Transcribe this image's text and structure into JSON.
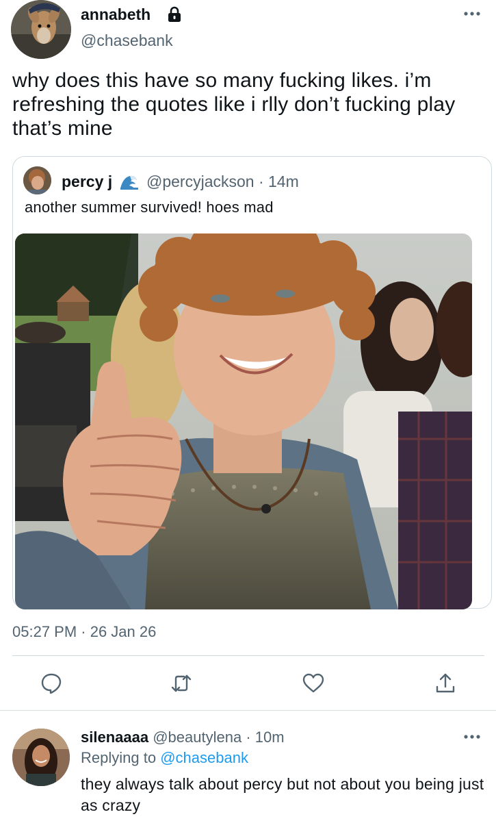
{
  "main_tweet": {
    "display_name": "annabeth",
    "handle": "@chasebank",
    "avatar_icon": "deer-avatar-icon",
    "protected_icon": "lock-icon",
    "text": "why does this have so many fucking likes. i’m refreshing the quotes like i rlly don’t fucking play that’s mine",
    "timestamp": "05:27 PM · 26 Jan 26"
  },
  "quoted_tweet": {
    "display_name": "percy j",
    "name_emoji_icon": "wave-icon",
    "handle": "@percyjackson",
    "age": "· 14m",
    "text": "another summer survived! hoes mad"
  },
  "actions": {
    "reply_icon": "reply-icon",
    "retweet_icon": "retweet-icon",
    "like_icon": "heart-icon",
    "share_icon": "share-icon"
  },
  "reply": {
    "display_name": "silenaaaa",
    "handle": "@beautylena",
    "age": "· 10m",
    "replying_label": "Replying to",
    "replying_handle": "@chasebank",
    "text": "they always talk about percy but not about you being just as crazy"
  },
  "colors": {
    "text": "#0f1419",
    "secondary": "#536471",
    "link": "#1d9bf0",
    "border": "#cfd9de"
  }
}
